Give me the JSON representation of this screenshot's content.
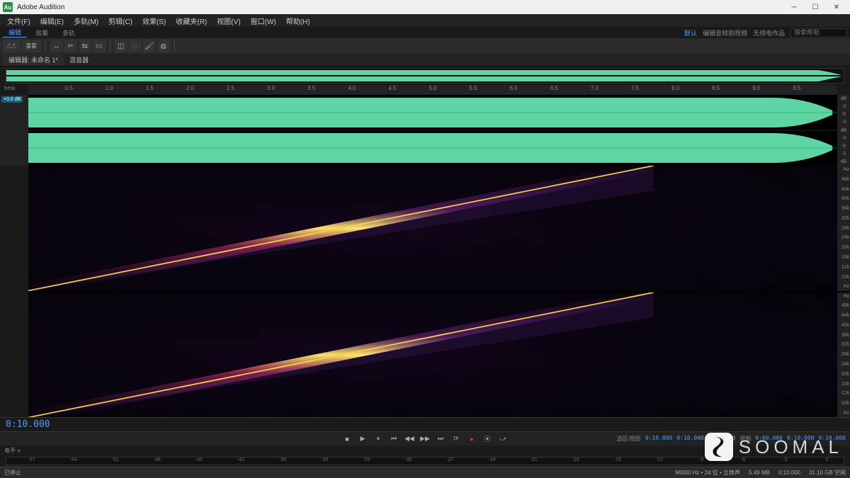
{
  "window": {
    "title": "Adobe Audition"
  },
  "menu": [
    "文件(F)",
    "编辑(E)",
    "多轨(M)",
    "剪辑(C)",
    "效果(S)",
    "收藏夹(R)",
    "视图(V)",
    "窗口(W)",
    "帮助(H)"
  ],
  "view_tabs": {
    "items": [
      "编辑",
      "效果",
      "多轨"
    ],
    "active": 0
  },
  "header_right": {
    "active": "默认",
    "links": [
      "编辑音频到视频",
      "无线电作品"
    ],
    "search_placeholder": "搜索帮助"
  },
  "panel": {
    "tabs": [
      "编辑器: 未命名 1*",
      "混音器"
    ],
    "active": 0
  },
  "hms_label": "hms",
  "db_badge": "+0.0 dB",
  "timeline_ticks": [
    "0.5",
    "1.0",
    "1.5",
    "2.0",
    "2.5",
    "3.0",
    "3.5",
    "4.0",
    "4.5",
    "5.0",
    "5.5",
    "6.0",
    "6.5",
    "7.0",
    "7.5",
    "8.0",
    "8.5",
    "9.0",
    "9.5"
  ],
  "wave_scale": [
    "dB",
    "-3",
    "-6",
    "-3",
    "dB",
    "-3",
    "-6",
    "-3",
    "dB"
  ],
  "freq_scale": [
    "Hz",
    "48k",
    "44k",
    "40k",
    "36k",
    "32k",
    "28k",
    "24k",
    "20k",
    "16k",
    "12k",
    "10k",
    "Hz"
  ],
  "timecode": "0:10.000",
  "transport": {
    "buttons": [
      "stop",
      "play",
      "pause",
      "skip-start",
      "rewind",
      "fforward",
      "skip-end",
      "loop",
      "record",
      "punch",
      "metronome"
    ]
  },
  "readout": {
    "section_label": "选区/视图",
    "sel_start": "0:10.000",
    "sel_end": "0:10.000",
    "sel_dur": "0:00.000",
    "view_label": "视图",
    "view_start": "0:00.000",
    "view_end": "0:10.000",
    "view_dur": "0:10.000"
  },
  "levels_label": "电平 ≡",
  "meter_ticks": [
    "-57",
    "-54",
    "-51",
    "-48",
    "-45",
    "-42",
    "-39",
    "-36",
    "-33",
    "-30",
    "-27",
    "-24",
    "-21",
    "-18",
    "-15",
    "-12",
    "-9",
    "-6",
    "-3",
    "0"
  ],
  "status": {
    "state": "已停止",
    "rate": "96000 Hz • 24 位 • 立体声",
    "size": "5.49 MB",
    "dur": "0:10.000",
    "disk": "31.10 GB 空闲"
  },
  "watermark": "SOOMAL"
}
